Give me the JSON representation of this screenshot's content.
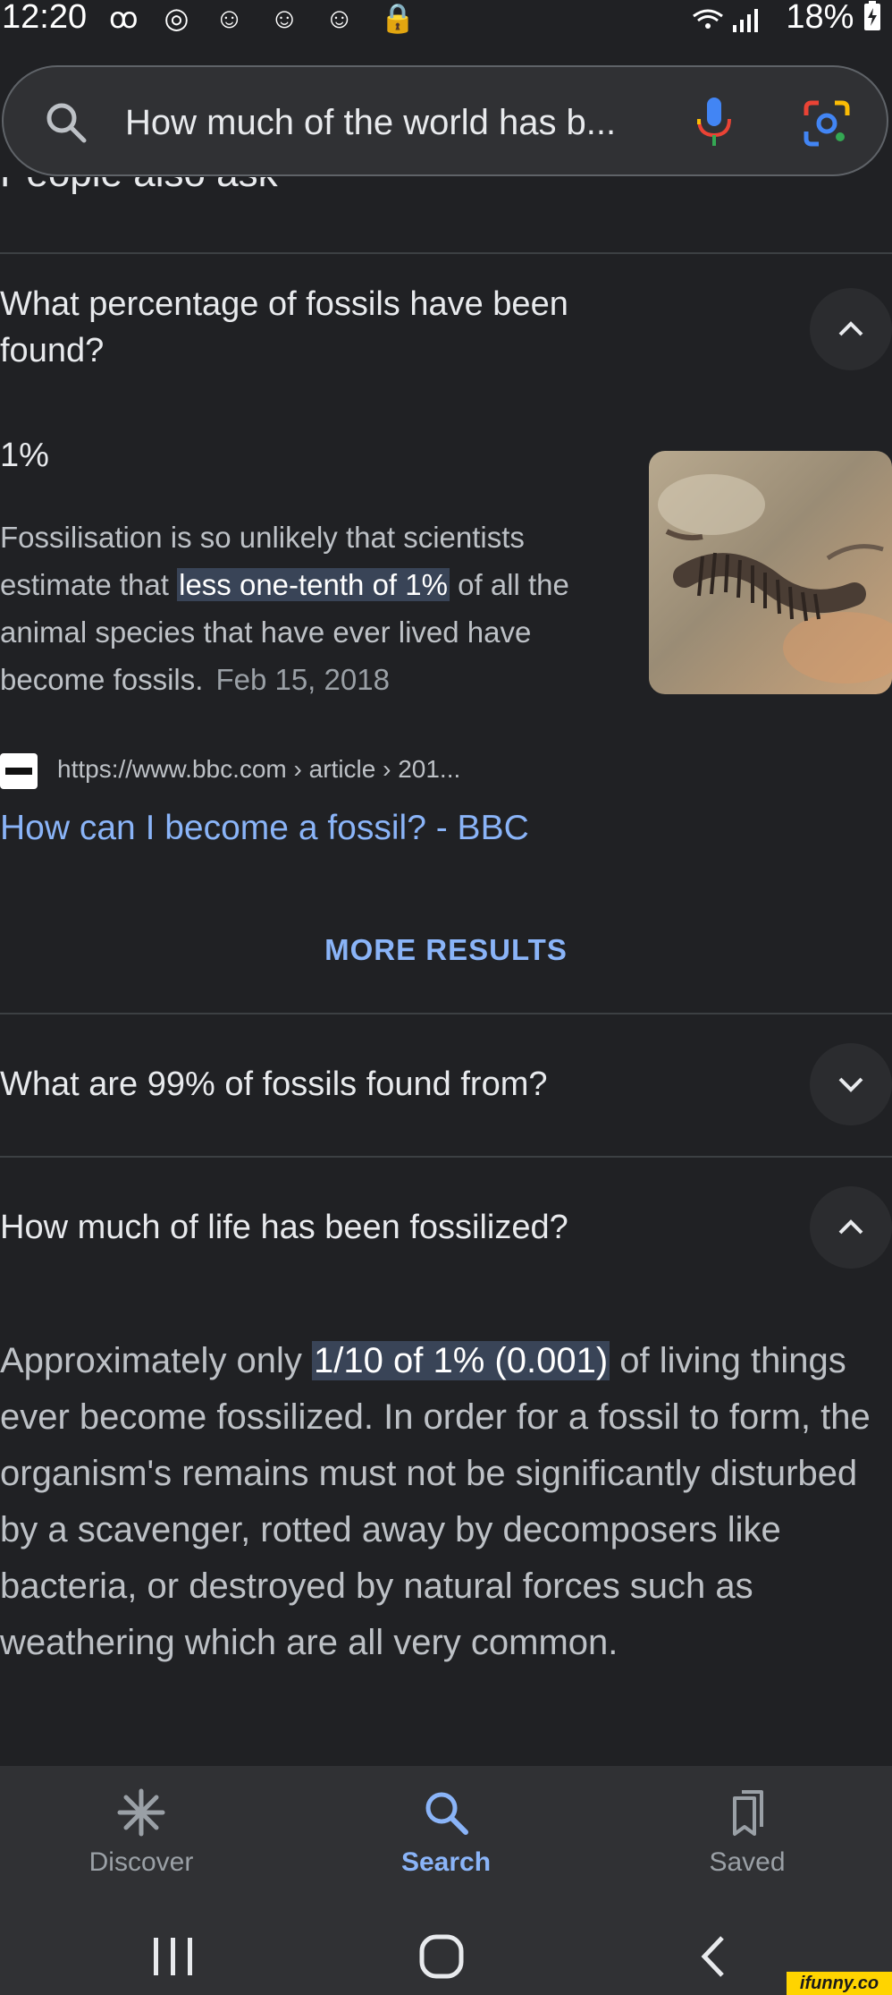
{
  "status_bar": {
    "time": "12:20",
    "left_icons": "ꝏ ◎ ☺ ☺ ☺ 🔒",
    "battery": "18%"
  },
  "search": {
    "query": "How much of the world has b..."
  },
  "paa_header": "People also ask",
  "questions": [
    {
      "title": "What percentage of fossils have been found?",
      "expanded": true,
      "short_answer": "1%",
      "body_pre": "Fossilisation is so unlikely that scientists estimate that ",
      "body_highlight": "less one-tenth of 1%",
      "body_post": " of all the animal species that have ever lived have become fossils.",
      "date": "Feb 15, 2018",
      "source_url": "https://www.bbc.com › article › 201...",
      "result_title": "How can I become a fossil? - BBC"
    },
    {
      "title": "What are 99% of fossils found from?",
      "expanded": false
    },
    {
      "title": "How much of life has been fossilized?",
      "expanded": true,
      "body_pre": "Approximately only ",
      "body_highlight": "1/10 of 1% (0.001)",
      "body_post": " of living things ever become fossilized. In order for a fossil to form, the organism's remains must not be significantly disturbed by a scavenger, rotted away by decomposers like bacteria, or destroyed by natural forces such as weathering which are all very common."
    }
  ],
  "more_results_label": "MORE RESULTS",
  "bottom_nav": {
    "discover": "Discover",
    "search": "Search",
    "saved": "Saved"
  },
  "watermark": "ifunny.co",
  "colors": {
    "background": "#202124",
    "link": "#8ab4f8",
    "highlight": "#394457"
  }
}
